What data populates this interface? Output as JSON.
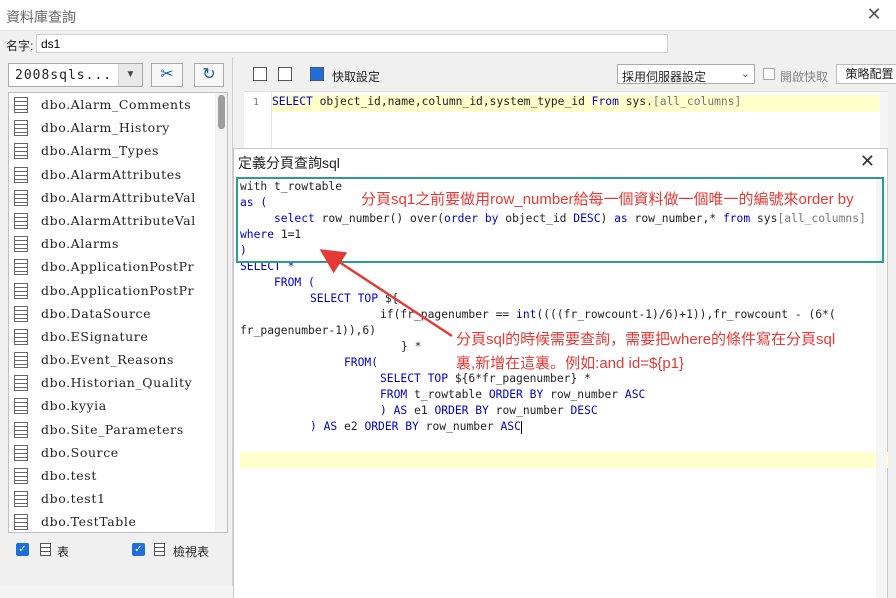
{
  "window": {
    "title": "資料庫查詢",
    "close_glyph": "✕"
  },
  "name_field": {
    "label": "名字:",
    "value": "ds1"
  },
  "left_panel": {
    "db_select": "2008sqls...",
    "tables": [
      "dbo.Alarm_Comments",
      "dbo.Alarm_History",
      "dbo.Alarm_Types",
      "dbo.AlarmAttributes",
      "dbo.AlarmAttributeVal",
      "dbo.AlarmAttributeVal",
      "dbo.Alarms",
      "dbo.ApplicationPostPr",
      "dbo.ApplicationPostPr",
      "dbo.DataSource",
      "dbo.ESignature",
      "dbo.Event_Reasons",
      "dbo.Historian_Quality",
      "dbo.kyyia",
      "dbo.Site_Parameters",
      "dbo.Source",
      "dbo.test",
      "dbo.test1",
      "dbo.TestTable"
    ],
    "check_table": "表",
    "check_view": "檢視表"
  },
  "toolbar": {
    "preview_label": "快取設定",
    "cache_select": "採用伺服器設定",
    "open_cache": "開啟快取",
    "strategy_button": "策略配置"
  },
  "editor": {
    "line_number": "1",
    "sql_select": "SELECT",
    "sql_cols": " object_id,name,column_id,system_type_id ",
    "sql_from": "From",
    "sql_table": " sys.",
    "sql_table2": "[all_columns]"
  },
  "dialog": {
    "title": "定義分頁查詢sql",
    "close_glyph": "✕",
    "code": {
      "l1": "with t_rowtable",
      "l2": "as (",
      "l3a": "select",
      "l3b": " row_number() over(",
      "l3c": "order by",
      "l3d": " object_id ",
      "l3e": "DESC",
      "l3f": ") ",
      "l3g": "as",
      "l3h": " row_number,* ",
      "l3i": "from",
      "l3j": " sys",
      "l3k": "[all_columns]",
      "l4a": "where",
      "l4b": " 1=1",
      "l5": ")",
      "l6": "SELECT *",
      "l7": "FROM (",
      "l8a": "SELECT TOP",
      "l8b": " ${",
      "l9a": "if(fr_pagenumber == ",
      "l9b": "int",
      "l9c": "((((fr_rowcount-1)/6)+1)),fr_rowcount - (6*(",
      "l10": "fr_pagenumber-1)),6)",
      "l11": "} *",
      "l12": "FROM(",
      "l13a": "SELECT TOP",
      "l13b": " ${6*fr_pagenumber} *",
      "l14a": "FROM",
      "l14b": " t_rowtable ",
      "l14c": "ORDER BY",
      "l14d": " row_number ",
      "l14e": "ASC",
      "l15a": ") ",
      "l15b": "AS",
      "l15c": " e1 ",
      "l15d": "ORDER BY",
      "l15e": " row_number ",
      "l15f": "DESC",
      "l16a": ") ",
      "l16b": "AS",
      "l16c": " e2 ",
      "l16d": "ORDER BY",
      "l16e": " row_number ",
      "l16f": "ASC"
    }
  },
  "annotations": {
    "top": "分頁sq1之前要做用row_number給每一個資料做一個唯一的編號來order by",
    "bottom_1": "分頁sql的時候需要查詢，需要把where的條件寫在分頁sql",
    "bottom_2": "裏,新增在這裏。例如:and id=${p1}"
  },
  "colors": {
    "keyword": "#0000c8",
    "annotation": "#e53935",
    "highlight_box": "#2a9d8f",
    "line_highlight": "#ffffcc"
  }
}
